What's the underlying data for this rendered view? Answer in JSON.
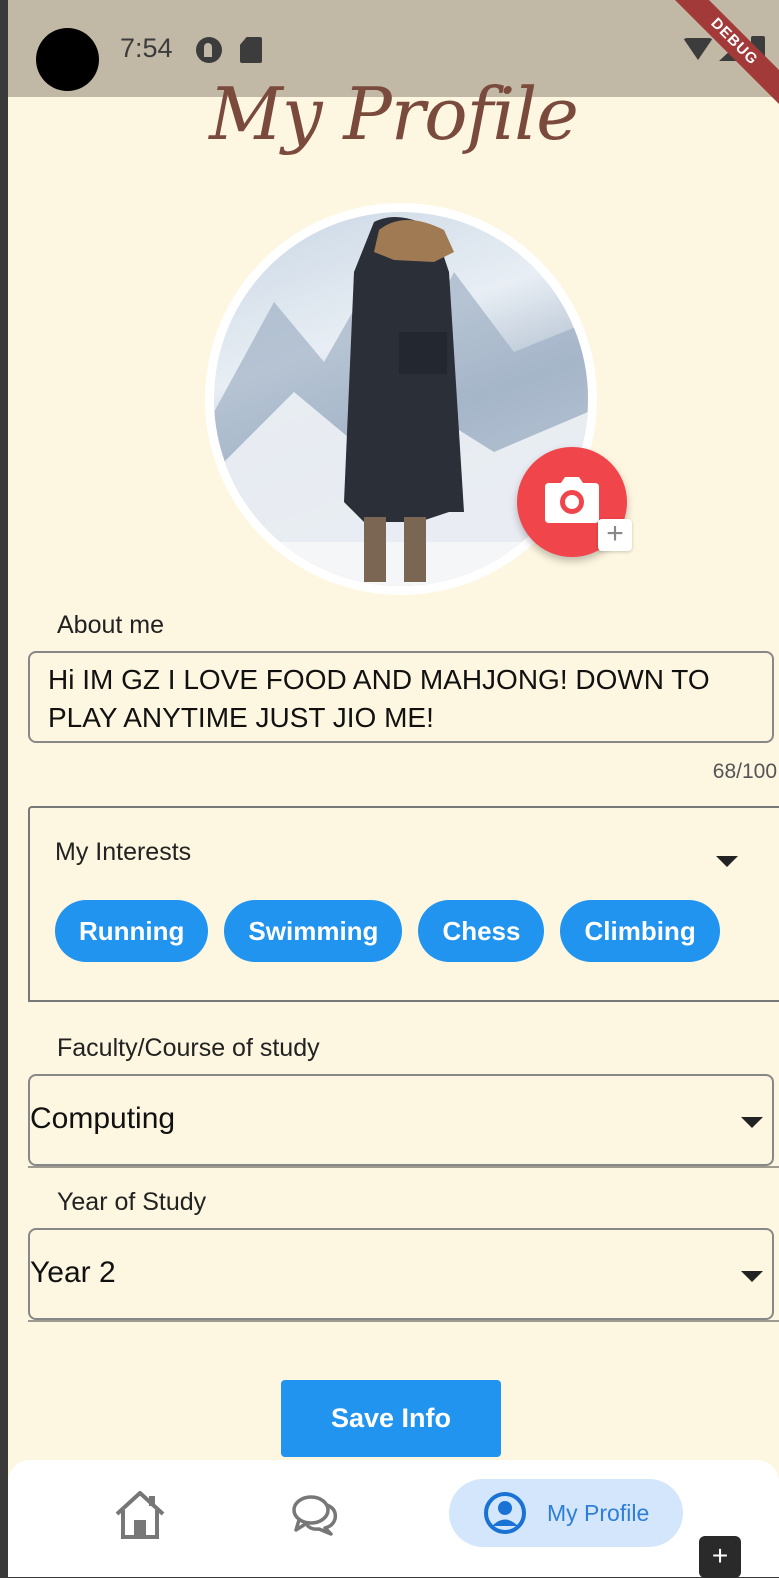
{
  "status_bar": {
    "time": "7:54",
    "debug_banner": "DEBUG"
  },
  "page": {
    "title": "My Profile"
  },
  "about": {
    "label": "About me",
    "text": "Hi IM GZ I LOVE FOOD AND MAHJONG! DOWN TO PLAY ANYTIME JUST JIO ME!",
    "counter": "68/100"
  },
  "interests": {
    "label": "My Interests",
    "chips": [
      "Running",
      "Swimming",
      "Chess",
      "Climbing"
    ]
  },
  "faculty": {
    "label": "Faculty/Course of study",
    "value": "Computing"
  },
  "year": {
    "label": "Year of Study",
    "value": "Year 2"
  },
  "save_button": {
    "label": "Save Info"
  },
  "nav": {
    "items": [
      {
        "icon": "home-icon",
        "label": ""
      },
      {
        "icon": "chat-icon",
        "label": ""
      },
      {
        "icon": "profile-icon",
        "label": "My Profile",
        "active": true
      }
    ]
  },
  "photo_add_badge": "+",
  "corner_button": "+",
  "colors": {
    "background": "#fdf6e0",
    "accent": "#2194f0",
    "camera_button": "#f0454a",
    "title": "#7a4a3c",
    "nav_active_bg": "#d3e6fb"
  }
}
